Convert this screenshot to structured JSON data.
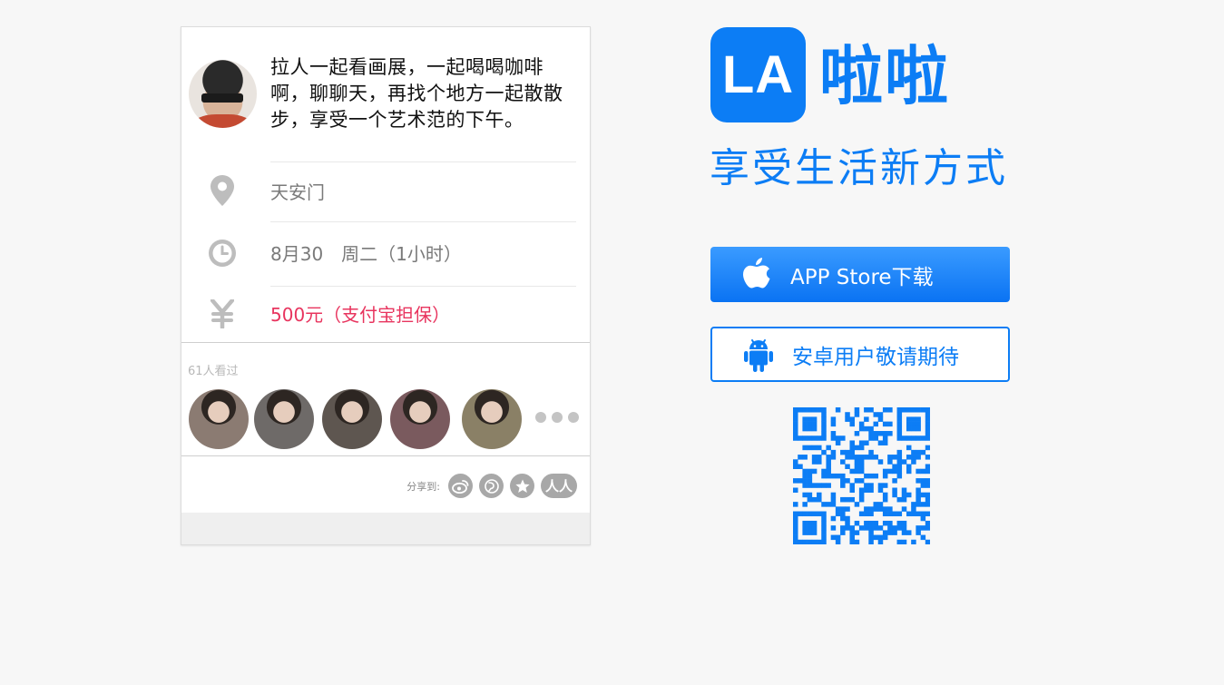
{
  "event": {
    "description": "拉人一起看画展，一起喝喝咖啡啊，聊聊天，再找个地方一起散散步，享受一个艺术范的下午。",
    "location": "天安门",
    "time": "8月30　周二（1小时）",
    "price": "500元（支付宝担保）",
    "viewers_count": "61人看过",
    "share_label": "分享到:",
    "share_icons": [
      "weibo-icon",
      "qq-zone-icon",
      "favorite-star-icon",
      "renren-icon"
    ],
    "share_glyphs": [
      "",
      "",
      "",
      "人人"
    ],
    "viewer_avatar_colors": [
      "#8b7b72",
      "#6e6a68",
      "#5e5650",
      "#7a5a5e",
      "#8a8066"
    ]
  },
  "brand": {
    "logo_text": "LA",
    "name": "啦啦",
    "slogan": "享受生活新方式",
    "accent_color": "#0c7df5",
    "price_color": "#e8345e"
  },
  "buttons": {
    "ios_label": "APP Store下载",
    "android_label": "安卓用户敬请期待"
  }
}
